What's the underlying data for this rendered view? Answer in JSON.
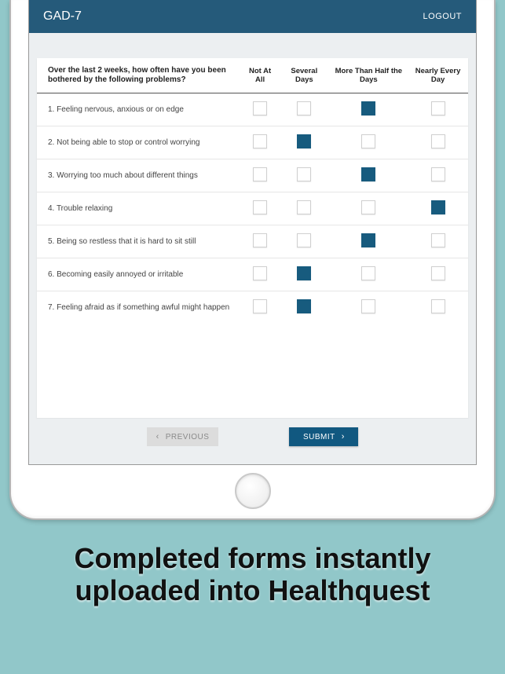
{
  "header": {
    "title": "GAD-7",
    "logout_label": "LOGOUT"
  },
  "prompt": "Over the last 2 weeks, how often have you been bothered by the following problems?",
  "columns": [
    "Not At All",
    "Several Days",
    "More Than Half the Days",
    "Nearly Every Day"
  ],
  "questions": [
    {
      "label": "1. Feeling nervous, anxious or on edge",
      "selected": 2
    },
    {
      "label": "2. Not being able to stop or control worrying",
      "selected": 1
    },
    {
      "label": "3. Worrying too much about different things",
      "selected": 2
    },
    {
      "label": "4. Trouble relaxing",
      "selected": 3
    },
    {
      "label": "5. Being so restless that it is hard to sit still",
      "selected": 2
    },
    {
      "label": "6. Becoming easily annoyed or irritable",
      "selected": 1
    },
    {
      "label": "7. Feeling afraid as if something awful might happen",
      "selected": 1
    }
  ],
  "buttons": {
    "previous": "PREVIOUS",
    "submit": "SUBMIT"
  },
  "caption": "Completed forms instantly uploaded into Healthquest"
}
